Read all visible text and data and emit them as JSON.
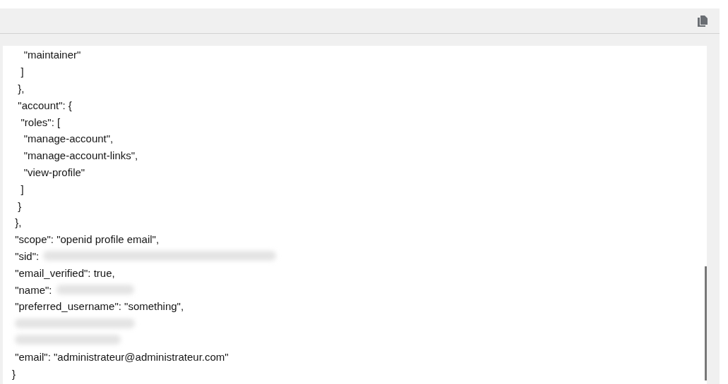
{
  "code_lines": [
    {
      "text": "    \"maintainer\""
    },
    {
      "text": "   ]"
    },
    {
      "text": "  },"
    },
    {
      "text": "  \"account\": {"
    },
    {
      "text": "   \"roles\": ["
    },
    {
      "text": "    \"manage-account\","
    },
    {
      "text": "    \"manage-account-links\","
    },
    {
      "text": "    \"view-profile\""
    },
    {
      "text": "   ]"
    },
    {
      "text": "  }"
    },
    {
      "text": " },"
    },
    {
      "text": " \"scope\": \"openid profile email\","
    },
    {
      "text": " \"sid\":",
      "redacted": true
    },
    {
      "text": " \"email_verified\": true,"
    },
    {
      "text": " \"name\":",
      "redacted": true
    },
    {
      "text": " \"preferred_username\": \"something\","
    },
    {
      "redacted": true
    },
    {
      "redacted": true
    },
    {
      "text": " \"email\": \"administrateur@administrateur.com\""
    },
    {
      "text": "}"
    }
  ]
}
